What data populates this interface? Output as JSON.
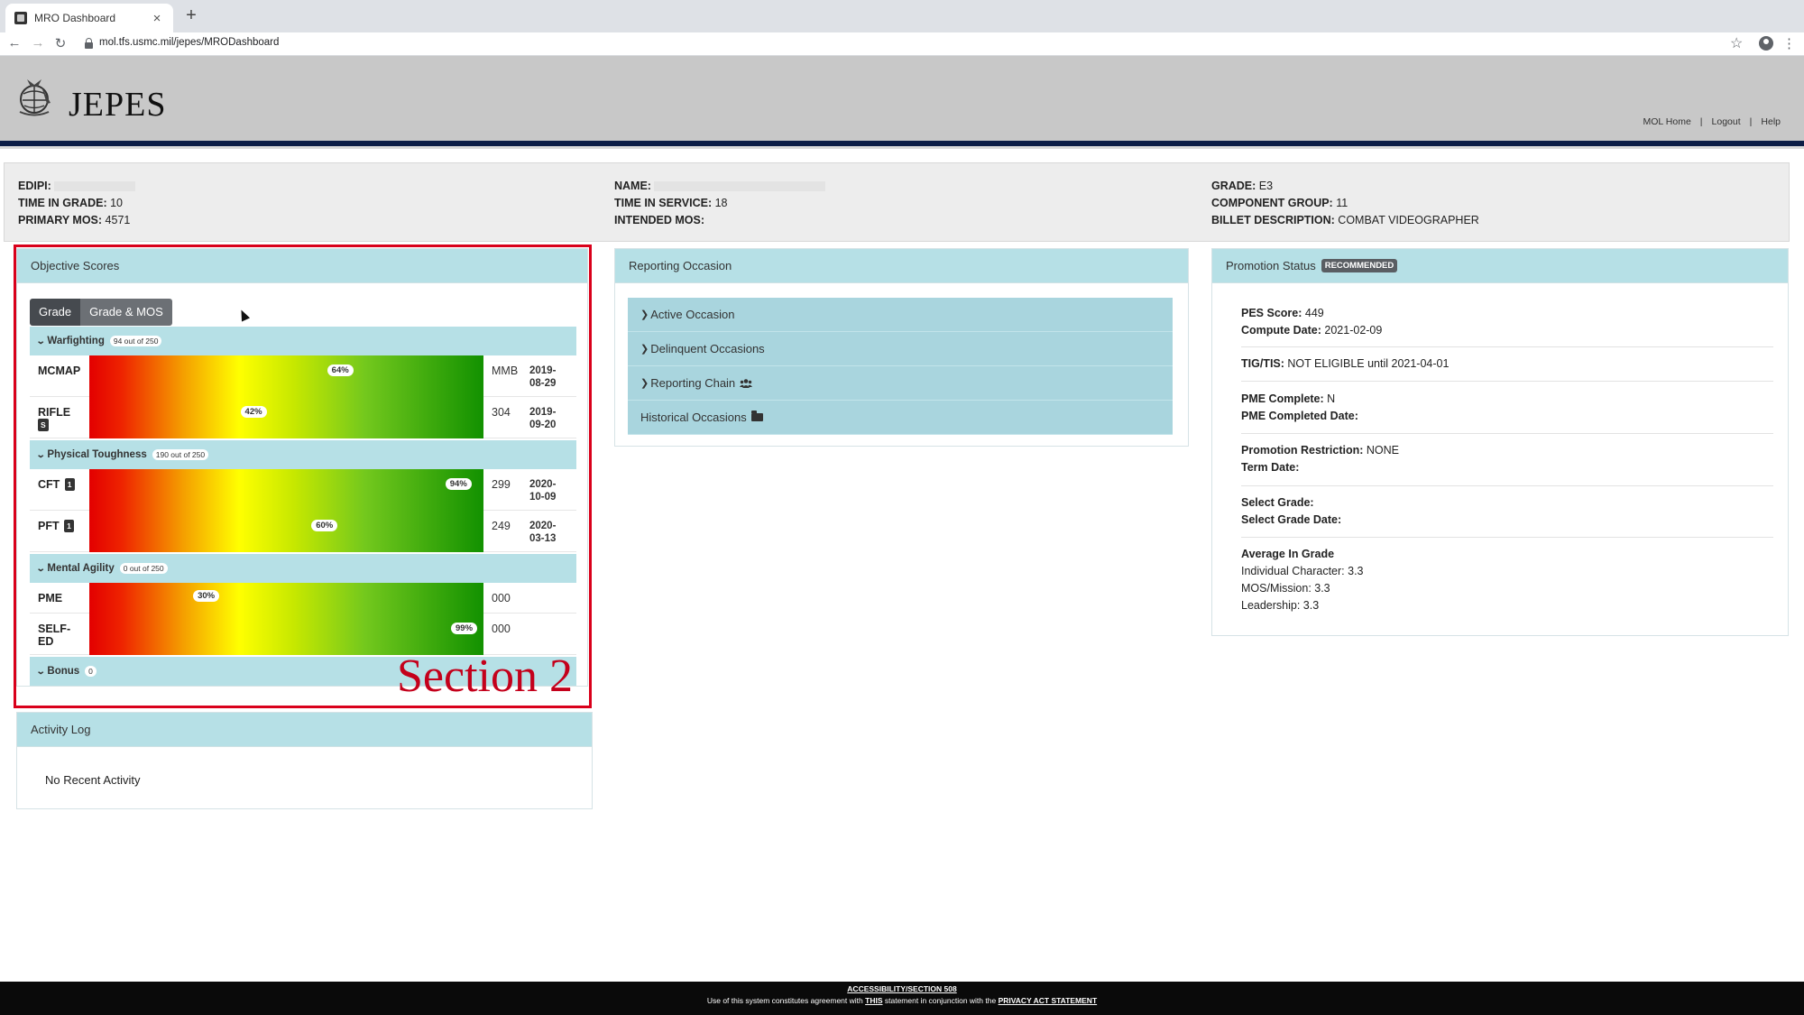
{
  "browser": {
    "tab_title": "MRO Dashboard",
    "tab_close": "×",
    "new_tab": "+",
    "back": "←",
    "forward": "→",
    "reload": "↻",
    "url": "mol.tfs.usmc.mil/jepes/MRODashboard",
    "star": "☆",
    "menu": "⋮"
  },
  "header": {
    "title": "JEPES",
    "links": [
      "MOL Home",
      "Logout",
      "Help"
    ],
    "separator": "|"
  },
  "info": {
    "edipi_label": "EDIPI:",
    "tig_label": "TIME IN GRADE:",
    "tig_value": "10",
    "pmos_label": "PRIMARY MOS:",
    "pmos_value": "4571",
    "name_label": "NAME:",
    "tis_label": "TIME IN SERVICE:",
    "tis_value": "18",
    "imos_label": "INTENDED MOS:",
    "grade_label": "GRADE:",
    "grade_value": "E3",
    "component_label": "COMPONENT GROUP:",
    "component_value": "11",
    "billet_label": "BILLET DESCRIPTION:",
    "billet_value": "COMBAT VIDEOGRAPHER"
  },
  "objective": {
    "title": "Objective Scores",
    "toggle": [
      "Grade",
      "Grade & MOS"
    ],
    "sections": [
      {
        "name": "Warfighting",
        "badge": "94 out of 250"
      },
      {
        "name": "Physical Toughness",
        "badge": "190 out of 250"
      },
      {
        "name": "Mental Agility",
        "badge": "0 out of 250"
      },
      {
        "name": "Bonus",
        "badge": "0"
      }
    ],
    "rows": [
      {
        "name": "MCMAP",
        "tag": "",
        "percent": 64,
        "percent_label": "64%",
        "score": "MMB",
        "date_a": "2019-",
        "date_b": "08-29"
      },
      {
        "name": "RIFLE",
        "tag": "S",
        "percent": 42,
        "percent_label": "42%",
        "score": "304",
        "date_a": "2019-",
        "date_b": "09-20"
      },
      {
        "name": "CFT",
        "tag": "1",
        "percent": 94,
        "percent_label": "94%",
        "score": "299",
        "date_a": "2020-",
        "date_b": "10-09"
      },
      {
        "name": "PFT",
        "tag": "1",
        "percent": 60,
        "percent_label": "60%",
        "score": "249",
        "date_a": "2020-",
        "date_b": "03-13"
      },
      {
        "name": "PME",
        "tag": "",
        "percent": 30,
        "percent_label": "30%",
        "score": "000",
        "date_a": "",
        "date_b": ""
      },
      {
        "name": "SELF-",
        "name2": "ED",
        "tag": "",
        "percent": 99,
        "percent_label": "99%",
        "score": "000",
        "date_a": "",
        "date_b": ""
      }
    ]
  },
  "activity": {
    "title": "Activity Log",
    "empty": "No Recent Activity"
  },
  "reporting": {
    "title": "Reporting Occasion",
    "items": [
      "Active Occasion",
      "Delinquent Occasions",
      "Reporting Chain",
      "Historical Occasions"
    ]
  },
  "promotion": {
    "title": "Promotion Status",
    "badge": "RECOMMENDED",
    "pes_label": "PES Score:",
    "pes_value": "449",
    "compute_label": "Compute Date:",
    "compute_value": "2021-02-09",
    "tig_tis_label": "TIG/TIS:",
    "tig_tis_value": "NOT ELIGIBLE until 2021-04-01",
    "pme_label": "PME Complete:",
    "pme_value": "N",
    "pme_date_label": "PME Completed Date:",
    "restriction_label": "Promotion Restriction:",
    "restriction_value": "NONE",
    "term_label": "Term Date:",
    "select_grade_label": "Select Grade:",
    "select_date_label": "Select Grade Date:",
    "avg_label": "Average In Grade",
    "avg_items": [
      "Individual Character: 3.3",
      "MOS/Mission: 3.3",
      "Leadership: 3.3"
    ]
  },
  "annotation": {
    "label": "Section 2",
    "color": "#d9001b"
  },
  "footer": {
    "accessibility": "ACCESSIBILITY/SECTION 508",
    "text_1": "Use of this system constitutes agreement with",
    "this_link": "THIS",
    "text_2": "statement in conjunction with the",
    "privacy_link": "PRIVACY ACT STATEMENT"
  },
  "icons": {
    "reporting_chain": "users-icon",
    "historical": "folder-open-icon"
  }
}
